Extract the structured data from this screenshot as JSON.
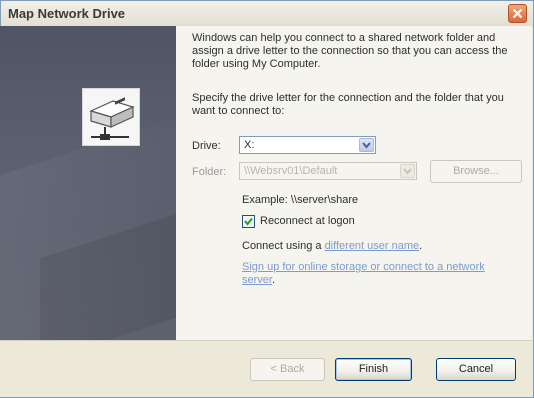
{
  "window": {
    "title": "Map Network Drive",
    "close_icon": "close-icon"
  },
  "intro": {
    "text": "Windows can help you connect to a shared network folder and assign a drive letter to the connection so that you can access the folder using My Computer."
  },
  "specify": {
    "text": "Specify the drive letter for the connection and the folder that you want to connect to:"
  },
  "drive": {
    "label": "Drive:",
    "value": "X:"
  },
  "folder": {
    "label": "Folder:",
    "value": "\\\\Websrv01\\Default",
    "browse_label": "Browse..."
  },
  "example": {
    "text": "Example: \\\\server\\share"
  },
  "reconnect": {
    "label": "Reconnect at logon",
    "checked": true
  },
  "connect_using": {
    "prefix": "Connect using a ",
    "link": "different user name",
    "suffix": "."
  },
  "signup": {
    "link": "Sign up for online storage or connect to a network server",
    "suffix": "."
  },
  "buttons": {
    "back": "< Back",
    "finish": "Finish",
    "cancel": "Cancel"
  },
  "colors": {
    "side_panel": "#585d6c",
    "link": "#3d6fb8",
    "close_button": "#d9673a"
  }
}
